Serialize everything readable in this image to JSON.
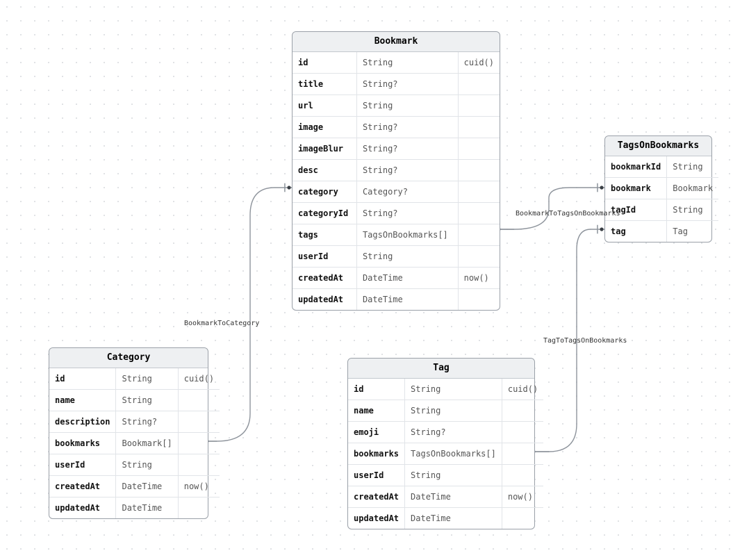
{
  "entities": {
    "bookmark": {
      "title": "Bookmark",
      "rows": [
        {
          "name": "id",
          "type": "String",
          "def": "cuid()"
        },
        {
          "name": "title",
          "type": "String?",
          "def": ""
        },
        {
          "name": "url",
          "type": "String",
          "def": ""
        },
        {
          "name": "image",
          "type": "String?",
          "def": ""
        },
        {
          "name": "imageBlur",
          "type": "String?",
          "def": ""
        },
        {
          "name": "desc",
          "type": "String?",
          "def": ""
        },
        {
          "name": "category",
          "type": "Category?",
          "def": ""
        },
        {
          "name": "categoryId",
          "type": "String?",
          "def": ""
        },
        {
          "name": "tags",
          "type": "TagsOnBookmarks[]",
          "def": ""
        },
        {
          "name": "userId",
          "type": "String",
          "def": ""
        },
        {
          "name": "createdAt",
          "type": "DateTime",
          "def": "now()"
        },
        {
          "name": "updatedAt",
          "type": "DateTime",
          "def": ""
        }
      ]
    },
    "category": {
      "title": "Category",
      "rows": [
        {
          "name": "id",
          "type": "String",
          "def": "cuid()"
        },
        {
          "name": "name",
          "type": "String",
          "def": ""
        },
        {
          "name": "description",
          "type": "String?",
          "def": ""
        },
        {
          "name": "bookmarks",
          "type": "Bookmark[]",
          "def": ""
        },
        {
          "name": "userId",
          "type": "String",
          "def": ""
        },
        {
          "name": "createdAt",
          "type": "DateTime",
          "def": "now()"
        },
        {
          "name": "updatedAt",
          "type": "DateTime",
          "def": ""
        }
      ]
    },
    "tag": {
      "title": "Tag",
      "rows": [
        {
          "name": "id",
          "type": "String",
          "def": "cuid()"
        },
        {
          "name": "name",
          "type": "String",
          "def": ""
        },
        {
          "name": "emoji",
          "type": "String?",
          "def": ""
        },
        {
          "name": "bookmarks",
          "type": "TagsOnBookmarks[]",
          "def": ""
        },
        {
          "name": "userId",
          "type": "String",
          "def": ""
        },
        {
          "name": "createdAt",
          "type": "DateTime",
          "def": "now()"
        },
        {
          "name": "updatedAt",
          "type": "DateTime",
          "def": ""
        }
      ]
    },
    "tagsOnBookmarks": {
      "title": "TagsOnBookmarks",
      "rows": [
        {
          "name": "bookmarkId",
          "type": "String"
        },
        {
          "name": "bookmark",
          "type": "Bookmark"
        },
        {
          "name": "tagId",
          "type": "String"
        },
        {
          "name": "tag",
          "type": "Tag"
        }
      ]
    }
  },
  "relations": {
    "bookmarkToCategory": "BookmarkToCategory",
    "bookmarkToTagsOnBookmarks": "BookmarkToTagsOnBookmarks",
    "tagToTagsOnBookmarks": "TagToTagsOnBookmarks"
  },
  "chart_data": {
    "type": "erd",
    "entities": [
      {
        "name": "Bookmark",
        "fields": [
          {
            "name": "id",
            "type": "String",
            "default": "cuid()"
          },
          {
            "name": "title",
            "type": "String?"
          },
          {
            "name": "url",
            "type": "String"
          },
          {
            "name": "image",
            "type": "String?"
          },
          {
            "name": "imageBlur",
            "type": "String?"
          },
          {
            "name": "desc",
            "type": "String?"
          },
          {
            "name": "category",
            "type": "Category?"
          },
          {
            "name": "categoryId",
            "type": "String?"
          },
          {
            "name": "tags",
            "type": "TagsOnBookmarks[]"
          },
          {
            "name": "userId",
            "type": "String"
          },
          {
            "name": "createdAt",
            "type": "DateTime",
            "default": "now()"
          },
          {
            "name": "updatedAt",
            "type": "DateTime"
          }
        ]
      },
      {
        "name": "Category",
        "fields": [
          {
            "name": "id",
            "type": "String",
            "default": "cuid()"
          },
          {
            "name": "name",
            "type": "String"
          },
          {
            "name": "description",
            "type": "String?"
          },
          {
            "name": "bookmarks",
            "type": "Bookmark[]"
          },
          {
            "name": "userId",
            "type": "String"
          },
          {
            "name": "createdAt",
            "type": "DateTime",
            "default": "now()"
          },
          {
            "name": "updatedAt",
            "type": "DateTime"
          }
        ]
      },
      {
        "name": "Tag",
        "fields": [
          {
            "name": "id",
            "type": "String",
            "default": "cuid()"
          },
          {
            "name": "name",
            "type": "String"
          },
          {
            "name": "emoji",
            "type": "String?"
          },
          {
            "name": "bookmarks",
            "type": "TagsOnBookmarks[]"
          },
          {
            "name": "userId",
            "type": "String"
          },
          {
            "name": "createdAt",
            "type": "DateTime",
            "default": "now()"
          },
          {
            "name": "updatedAt",
            "type": "DateTime"
          }
        ]
      },
      {
        "name": "TagsOnBookmarks",
        "fields": [
          {
            "name": "bookmarkId",
            "type": "String"
          },
          {
            "name": "bookmark",
            "type": "Bookmark"
          },
          {
            "name": "tagId",
            "type": "String"
          },
          {
            "name": "tag",
            "type": "Tag"
          }
        ]
      }
    ],
    "relations": [
      {
        "name": "BookmarkToCategory",
        "from": "Category.bookmarks",
        "to": "Bookmark.category",
        "cardinality": "one-to-many"
      },
      {
        "name": "BookmarkToTagsOnBookmarks",
        "from": "Bookmark.tags",
        "to": "TagsOnBookmarks.bookmark",
        "cardinality": "one-to-many"
      },
      {
        "name": "TagToTagsOnBookmarks",
        "from": "Tag.bookmarks",
        "to": "TagsOnBookmarks.tag",
        "cardinality": "one-to-many"
      }
    ]
  }
}
